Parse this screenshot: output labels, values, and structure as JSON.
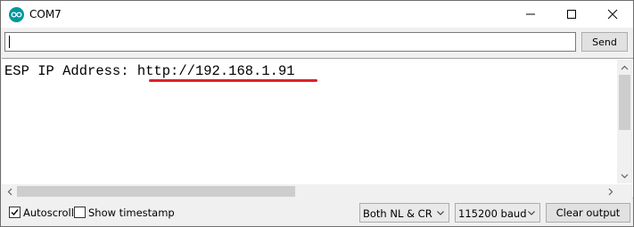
{
  "window": {
    "title": "COM7",
    "icon": "arduino-icon",
    "controls": [
      "minimize-icon",
      "maximize-icon",
      "close-icon"
    ]
  },
  "send": {
    "input_value": "",
    "button_label": "Send"
  },
  "output": {
    "label": "ESP IP Address: ",
    "url": "http://192.168.1.91",
    "highlight_color": "#e0202a"
  },
  "footer": {
    "autoscroll_label": "Autoscroll",
    "autoscroll_checked": true,
    "timestamp_label": "Show timestamp",
    "timestamp_checked": false,
    "line_ending": "Both NL & CR",
    "baud": "115200 baud",
    "clear_label": "Clear output"
  }
}
